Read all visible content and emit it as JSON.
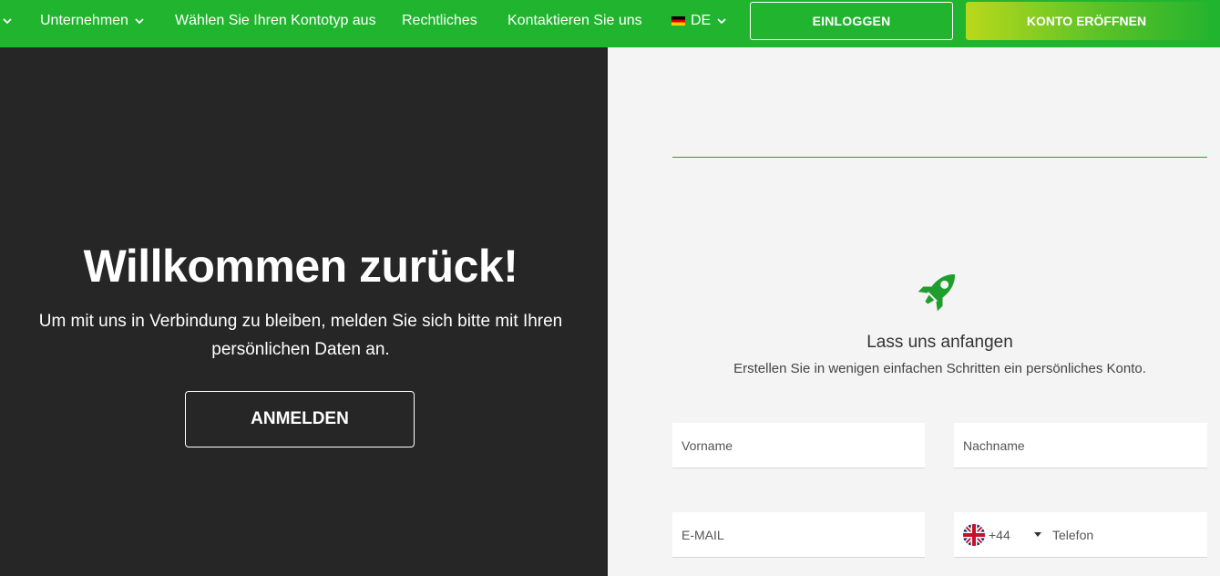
{
  "nav": {
    "items": [
      {
        "label": "Unternehmen",
        "has_chevron": true
      },
      {
        "label": "Wählen Sie Ihren Kontotyp aus",
        "has_chevron": false
      },
      {
        "label": "Rechtliches",
        "has_chevron": false
      },
      {
        "label": "Kontaktieren Sie uns",
        "has_chevron": false
      }
    ],
    "language": "DE",
    "login_label": "EINLOGGEN",
    "open_account_label": "KONTO ERÖFFNEN"
  },
  "left": {
    "title": "Willkommen zurück!",
    "subtitle": "Um mit uns in Verbindung zu bleiben, melden Sie sich bitte mit Ihren persönlichen Daten an.",
    "signin_label": "ANMELDEN"
  },
  "right": {
    "icon": "rocket-icon",
    "title": "Lass uns anfangen",
    "subtitle": "Erstellen Sie in wenigen einfachen Schritten ein persönliches Konto.",
    "form": {
      "first_name_placeholder": "Vorname",
      "last_name_placeholder": "Nachname",
      "email_placeholder": "E-MAIL",
      "phone_code": "+44",
      "phone_placeholder": "Telefon"
    }
  },
  "colors": {
    "nav_green": "#21b52f",
    "dark_panel": "#262626",
    "accent_green": "#1f9e2d",
    "light_panel": "#f4f4f4"
  }
}
